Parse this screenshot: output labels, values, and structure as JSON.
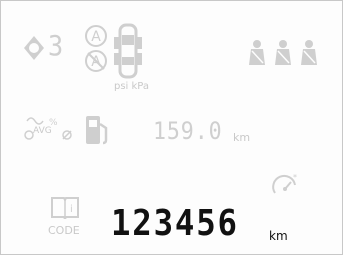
{
  "status": {
    "gear_value": "3",
    "tire_units": "psi kPa"
  },
  "trip": {
    "avg_label": "AVG",
    "range_value": "159.0",
    "range_unit": "km"
  },
  "odometer": {
    "code_label": "CODE",
    "value": "123456",
    "unit": "km"
  },
  "colors": {
    "inactive_segment": "#cfcfcf",
    "active_segment": "#111111",
    "background": "#fdfdfd"
  },
  "icons": [
    "stop-start-icon",
    "auto-stop-icon",
    "car-doors-icon",
    "seatbelt-icon",
    "fuel-consumption-icon",
    "fuel-pump-icon",
    "service-book-icon",
    "gauge-icon"
  ]
}
